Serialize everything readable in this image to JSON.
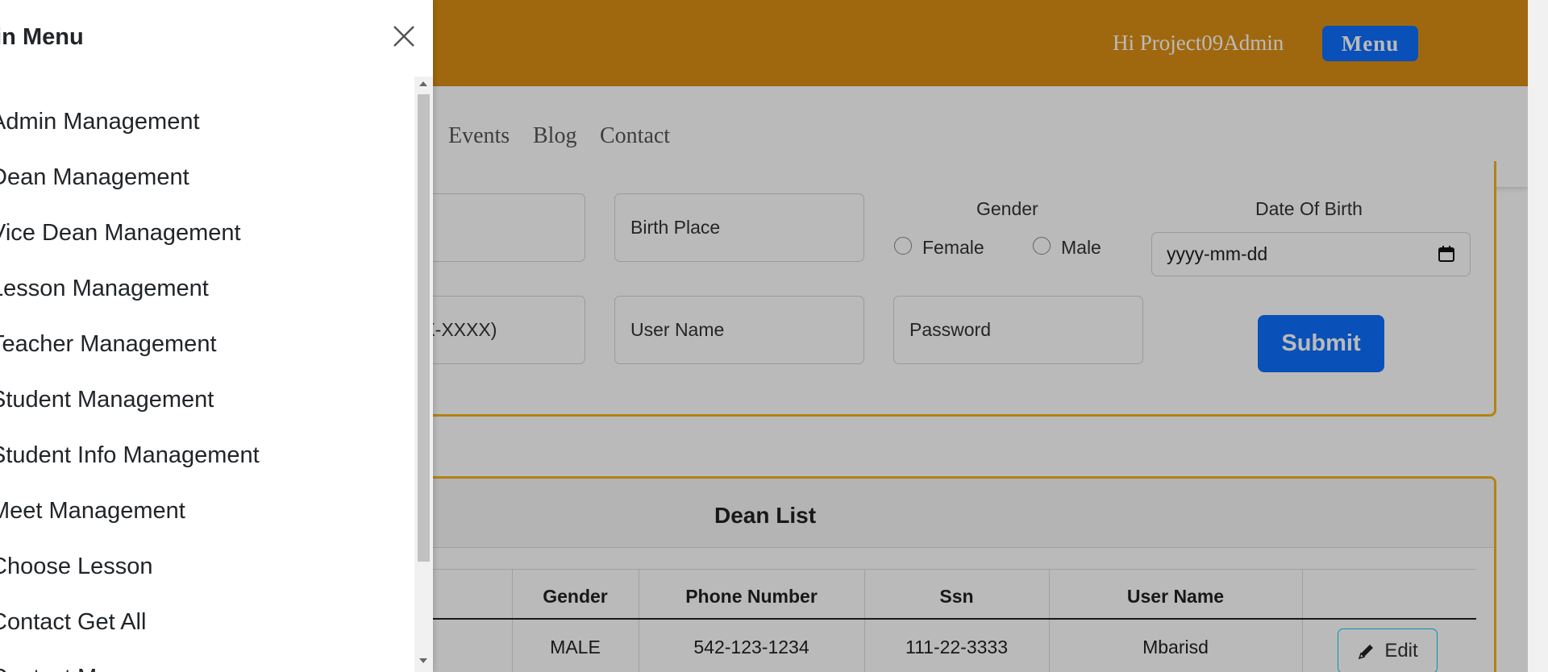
{
  "header": {
    "greeting": "Hi Project09Admin",
    "menu_label": "Menu",
    "brand_color": "#dc8f14",
    "accent_color": "#0d6efd"
  },
  "nav": {
    "links": [
      "Events",
      "Blog",
      "Contact"
    ]
  },
  "form": {
    "birth_place_placeholder": "Birth Place",
    "phone_placeholder_partial": "XX-XXXX)",
    "username_placeholder": "User Name",
    "password_placeholder": "Password",
    "gender_label": "Gender",
    "gender_options": [
      "Female",
      "Male"
    ],
    "dob_label": "Date Of Birth",
    "dob_placeholder": "yyyy-mm-dd",
    "submit_label": "Submit"
  },
  "dean_list": {
    "title": "Dean List",
    "columns": [
      "Gender",
      "Phone Number",
      "Ssn",
      "User Name"
    ],
    "rows": [
      {
        "gender": "MALE",
        "phone": "542-123-1234",
        "ssn": "111-22-3333",
        "username": "Mbarisd",
        "action": "Edit"
      }
    ]
  },
  "offcanvas": {
    "title": "ain Menu",
    "items": [
      "Admin Management",
      "Dean Management",
      "Vice Dean Management",
      "Lesson Management",
      "Teacher Management",
      "Student Management",
      "Student Info Management",
      "Meet Management",
      "Choose Lesson",
      "Contact Get All",
      "Contact Message"
    ],
    "icons": {
      "close": "close-icon",
      "edit": "pencil-icon",
      "calendar": "calendar-icon"
    }
  }
}
